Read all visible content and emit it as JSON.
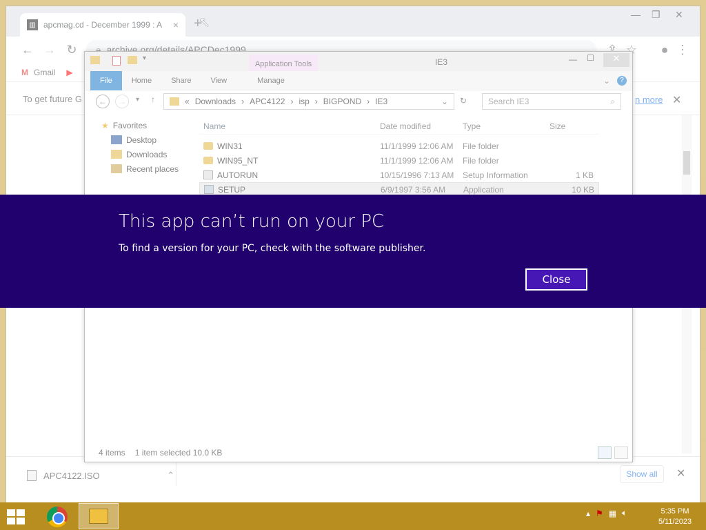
{
  "browser": {
    "tab_title": "apcmag.cd - December 1999 : A",
    "tab_close": "×",
    "new_tab": "+",
    "url": "archive.org/details/APCDec1999",
    "bookmarks": [
      "Gmail"
    ],
    "info_bar_text": "To get future G",
    "info_bar_link": "n more",
    "download_file": "APC4122.ISO",
    "show_all": "Show all"
  },
  "explorer": {
    "title": "IE3",
    "contextual_tab": "Application Tools",
    "ribbon_tabs": [
      "File",
      "Home",
      "Share",
      "View",
      "Manage"
    ],
    "breadcrumb": [
      "Downloads",
      "APC4122",
      "isp",
      "BIGPOND",
      "IE3"
    ],
    "breadcrumb_prefix": "«",
    "search_placeholder": "Search IE3",
    "nav": {
      "favorites": "Favorites",
      "items": [
        "Desktop",
        "Downloads",
        "Recent places"
      ]
    },
    "columns": [
      "Name",
      "Date modified",
      "Type",
      "Size"
    ],
    "rows": [
      {
        "name": "WIN31",
        "date": "11/1/1999 12:06 AM",
        "type": "File folder",
        "size": ""
      },
      {
        "name": "WIN95_NT",
        "date": "11/1/1999 12:06 AM",
        "type": "File folder",
        "size": ""
      },
      {
        "name": "AUTORUN",
        "date": "10/15/1996 7:13 AM",
        "type": "Setup Information",
        "size": "1 KB"
      },
      {
        "name": "SETUP",
        "date": "6/9/1997 3:56 AM",
        "type": "Application",
        "size": "10 KB"
      }
    ],
    "status": {
      "count": "4 items",
      "selection": "1 item selected  10.0 KB"
    }
  },
  "dialog": {
    "title": "This app can’t run on your PC",
    "message": "To find a version for your PC, check with the software publisher.",
    "close_label": "Close"
  },
  "taskbar": {
    "time": "5:35 PM",
    "date": "5/11/2023"
  },
  "colors": {
    "banner": "#20016e",
    "close_button": "#4617b4",
    "taskbar": "#b98e20"
  }
}
